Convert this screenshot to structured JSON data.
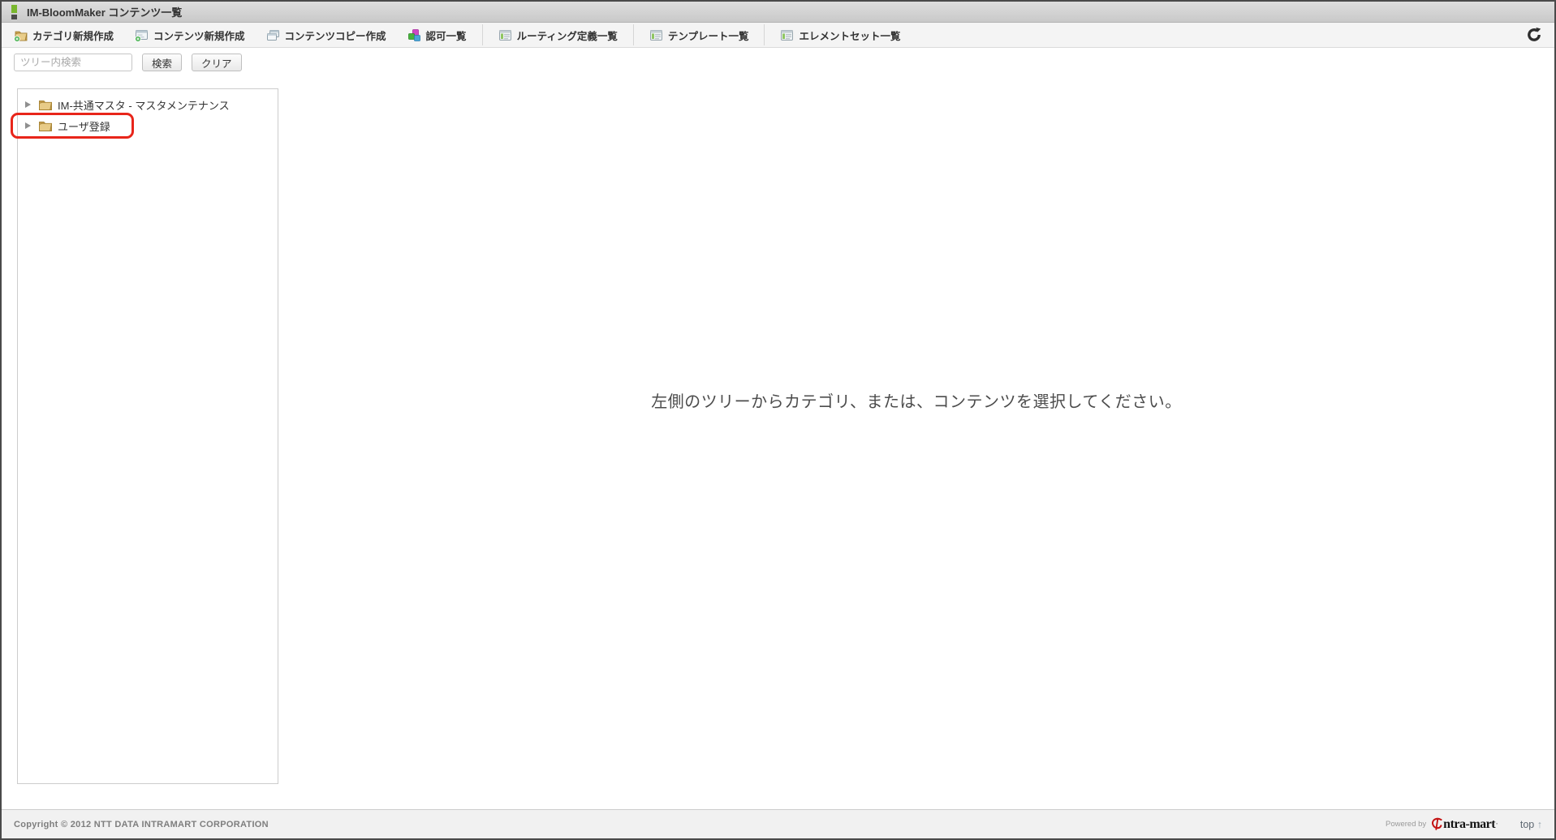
{
  "window": {
    "title": "IM-BloomMaker コンテンツ一覧"
  },
  "toolbar": {
    "items": [
      {
        "label": "カテゴリ新規作成",
        "icon": "folder-add-icon"
      },
      {
        "label": "コンテンツ新規作成",
        "icon": "content-add-icon"
      },
      {
        "label": "コンテンツコピー作成",
        "icon": "content-copy-icon"
      },
      {
        "label": "認可一覧",
        "icon": "authz-cubes-icon"
      },
      {
        "label": "ルーティング定義一覧",
        "icon": "routing-list-icon"
      },
      {
        "label": "テンプレート一覧",
        "icon": "template-list-icon"
      },
      {
        "label": "エレメントセット一覧",
        "icon": "elementset-list-icon"
      }
    ],
    "refresh_icon": "refresh-icon"
  },
  "search": {
    "placeholder": "ツリー内検索",
    "search_label": "検索",
    "clear_label": "クリア"
  },
  "tree": {
    "items": [
      {
        "label": "IM-共通マスタ - マスタメンテナンス",
        "highlighted": false
      },
      {
        "label": "ユーザ登録",
        "highlighted": true
      }
    ]
  },
  "main": {
    "empty_message": "左側のツリーからカテゴリ、または、コンテンツを選択してください。"
  },
  "footer": {
    "copyright": "Copyright © 2012 NTT DATA INTRAMART CORPORATION",
    "powered_by": "Powered by",
    "logo_text": "ntra-mart",
    "logo_mark": "’",
    "top_link": "top",
    "top_arrow": "↑"
  },
  "colors": {
    "highlight_red": "#e8251a",
    "accent_green": "#79b72e",
    "logo_red": "#c41212",
    "titlebar_gray": "#d3d3d3",
    "toolbar_gray": "#f4f4f4"
  }
}
